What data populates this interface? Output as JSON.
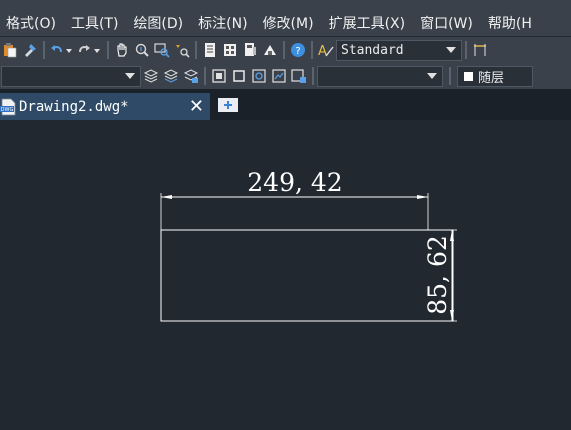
{
  "menu": {
    "items": [
      "格式(O)",
      "工具(T)",
      "绘图(D)",
      "标注(N)",
      "修改(M)",
      "扩展工具(X)",
      "窗口(W)",
      "帮助(H"
    ]
  },
  "toolbar": {
    "text_style_value": "Standard",
    "layer_value": "随层"
  },
  "tab": {
    "title": "Drawing2.dwg*",
    "close_glyph": "✕",
    "icon_text": "DWG"
  },
  "drawing": {
    "horizontal_dimension": "249, 42",
    "vertical_dimension": "85, 62"
  },
  "colors": {
    "background": "#212830",
    "menubar": "#3a414b",
    "active_tab": "#2e4a66",
    "line": "#ffffff"
  }
}
